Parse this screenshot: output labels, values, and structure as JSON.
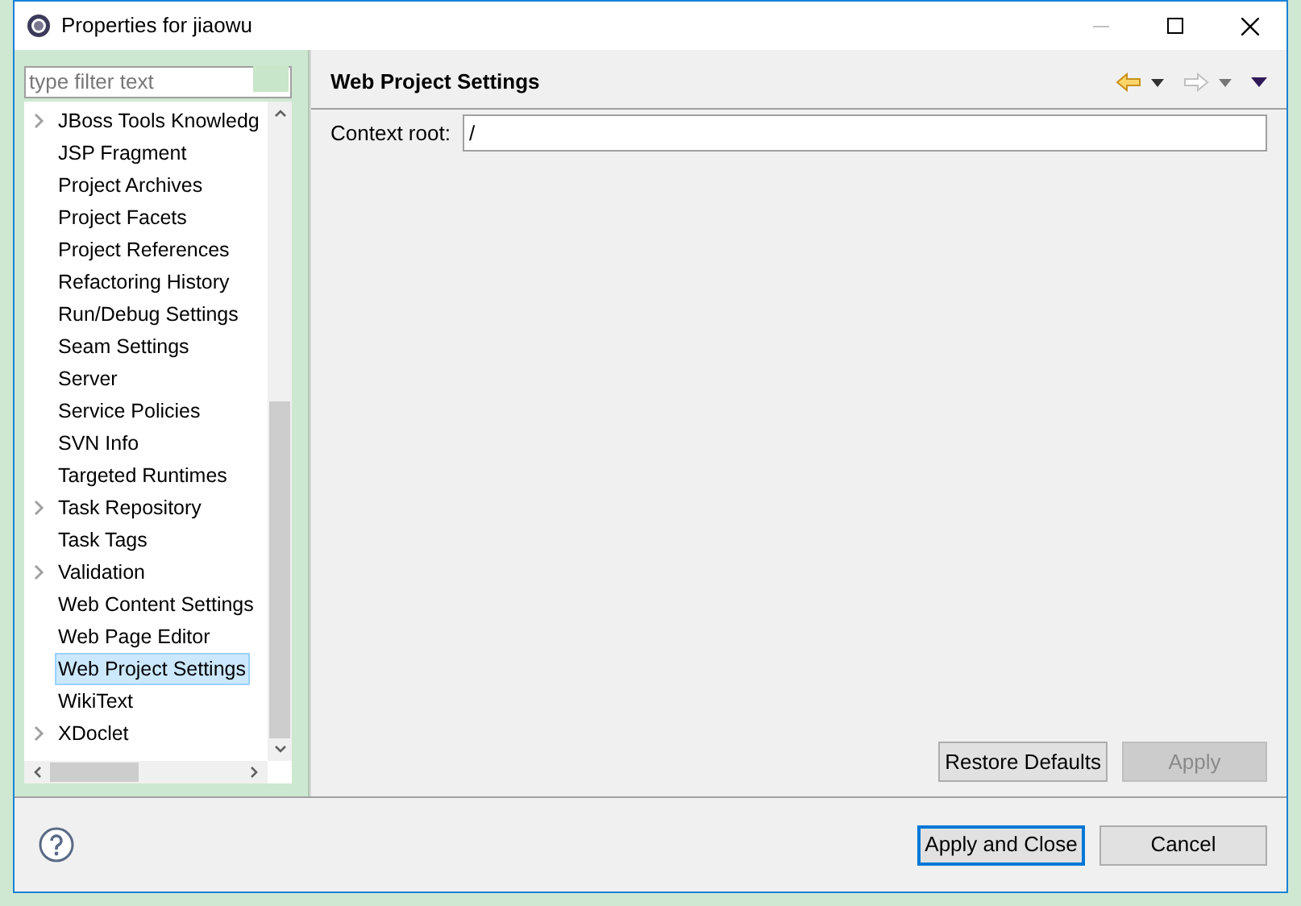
{
  "window": {
    "title": "Properties for jiaowu"
  },
  "filter": {
    "placeholder": "type filter text"
  },
  "tree": [
    {
      "label": "JBoss Tools Knowledg",
      "expandable": true,
      "selected": false
    },
    {
      "label": "JSP Fragment",
      "expandable": false,
      "selected": false
    },
    {
      "label": "Project Archives",
      "expandable": false,
      "selected": false
    },
    {
      "label": "Project Facets",
      "expandable": false,
      "selected": false
    },
    {
      "label": "Project References",
      "expandable": false,
      "selected": false
    },
    {
      "label": "Refactoring History",
      "expandable": false,
      "selected": false
    },
    {
      "label": "Run/Debug Settings",
      "expandable": false,
      "selected": false
    },
    {
      "label": "Seam Settings",
      "expandable": false,
      "selected": false
    },
    {
      "label": "Server",
      "expandable": false,
      "selected": false
    },
    {
      "label": "Service Policies",
      "expandable": false,
      "selected": false
    },
    {
      "label": "SVN Info",
      "expandable": false,
      "selected": false
    },
    {
      "label": "Targeted Runtimes",
      "expandable": false,
      "selected": false
    },
    {
      "label": "Task Repository",
      "expandable": true,
      "selected": false
    },
    {
      "label": "Task Tags",
      "expandable": false,
      "selected": false
    },
    {
      "label": "Validation",
      "expandable": true,
      "selected": false
    },
    {
      "label": "Web Content Settings",
      "expandable": false,
      "selected": false
    },
    {
      "label": "Web Page Editor",
      "expandable": false,
      "selected": false
    },
    {
      "label": "Web Project Settings",
      "expandable": false,
      "selected": true
    },
    {
      "label": "WikiText",
      "expandable": false,
      "selected": false
    },
    {
      "label": "XDoclet",
      "expandable": true,
      "selected": false
    }
  ],
  "page": {
    "title": "Web Project Settings",
    "fields": [
      {
        "label": "Context root:",
        "value": "/"
      }
    ]
  },
  "page_buttons": [
    {
      "label": "Restore Defaults",
      "disabled": false
    },
    {
      "label": "Apply",
      "disabled": true
    }
  ],
  "dialog_buttons": [
    {
      "label": "Apply and Close",
      "default": true
    },
    {
      "label": "Cancel",
      "default": false
    }
  ]
}
